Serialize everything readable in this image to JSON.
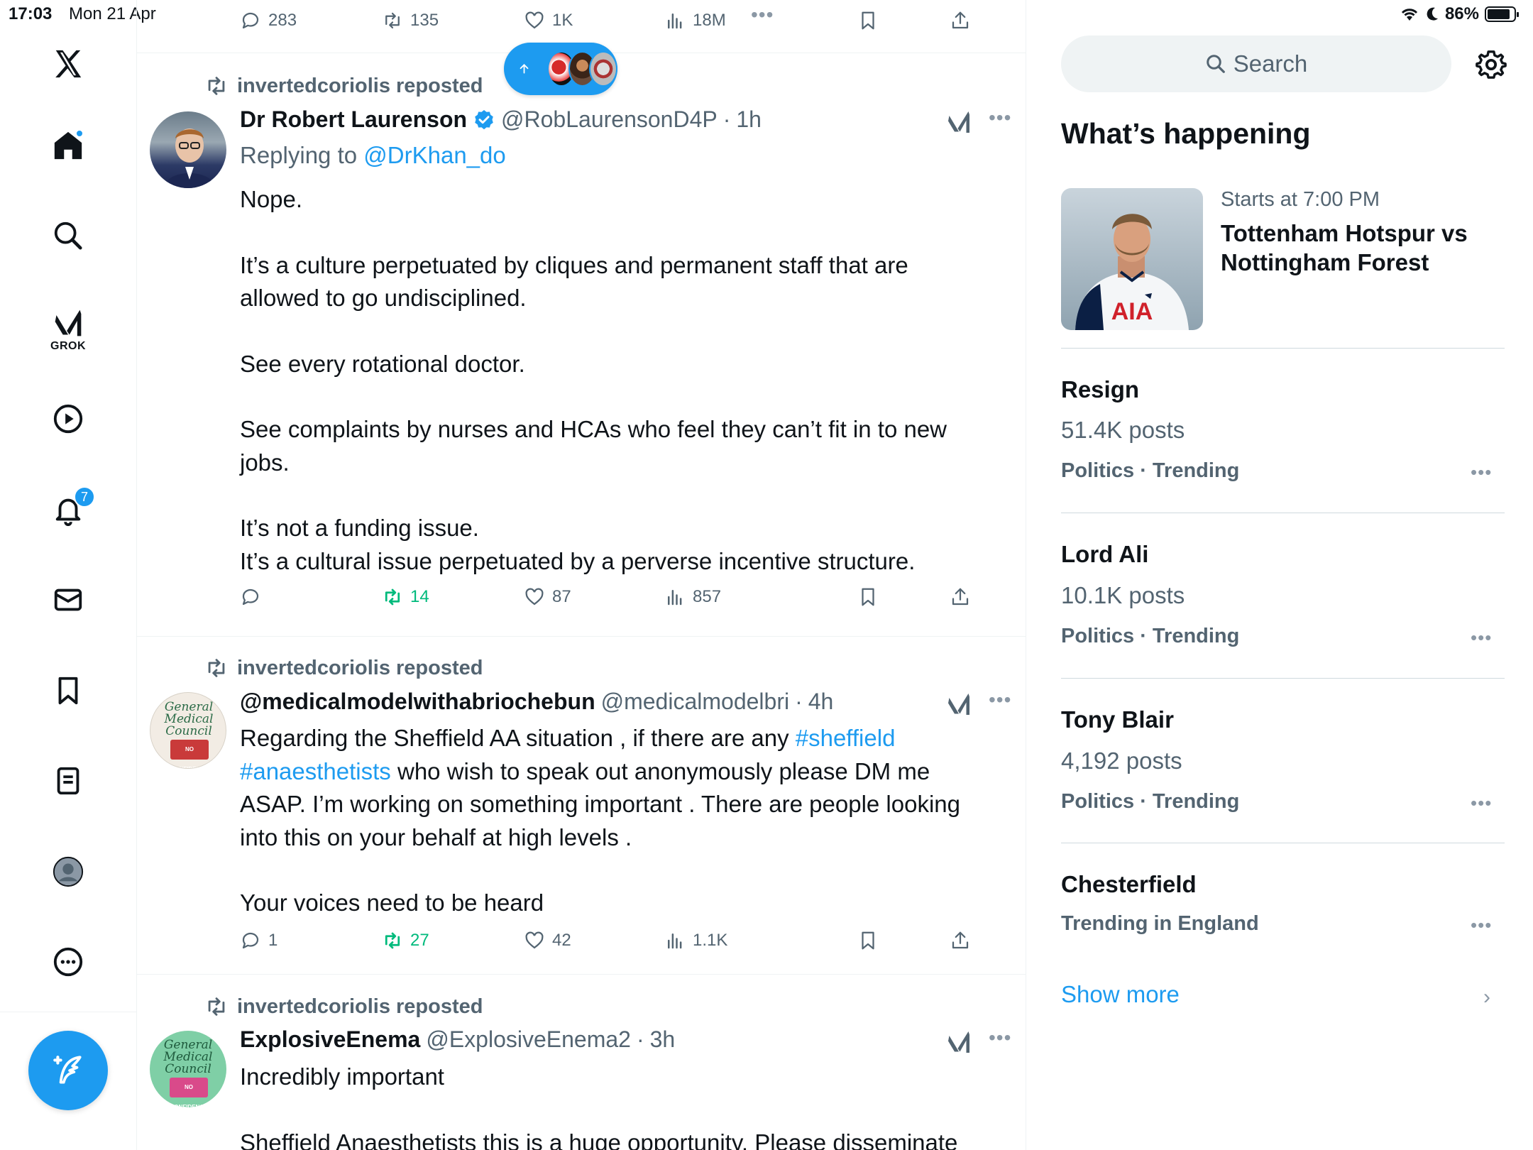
{
  "status_bar": {
    "time": "17:03",
    "date": "Mon 21 Apr",
    "battery": "86%",
    "battery_level": 0.86
  },
  "nav": {
    "grok_label": "GROK",
    "notifications_badge": "7"
  },
  "top_actions": {
    "replies": "283",
    "reposts": "135",
    "likes": "1K",
    "views": "18M"
  },
  "posts": [
    {
      "repost_label": "invertedcoriolis reposted",
      "name": "Dr Robert Laurenson",
      "handle": "@RobLaurensonD4P",
      "time": "1h",
      "replying_prefix": "Replying to",
      "replying_handle": "@DrKhan_do",
      "lines": [
        "Nope.",
        "",
        "It’s a culture perpetuated by cliques and permanent staff that are allowed to go undisciplined.",
        "",
        "See every rotational doctor.",
        "",
        "See complaints by nurses and HCAs who feel they can’t fit in to new jobs.",
        "",
        "It’s not a funding issue.",
        "It’s a cultural issue perpetuated by a perverse incentive structure."
      ],
      "replies": "",
      "reposts": "14",
      "likes": "87",
      "views": "857"
    },
    {
      "repost_label": "invertedcoriolis reposted",
      "name": "@medicalmodelwithabriochebun",
      "handle": "@medicalmodelbri",
      "time": "4h",
      "text_a": "Regarding the Sheffield AA situation , if there are any ",
      "tag1": "#sheffield",
      "tag2": "#anaesthetists",
      "text_b": " who wish to speak out anonymously please DM me ASAP. I’m working on something important . There are people looking into this on your behalf at high levels .",
      "text_c": "Your voices need to be heard",
      "replies": "1",
      "reposts": "27",
      "likes": "42",
      "views": "1.1K"
    },
    {
      "repost_label": "invertedcoriolis reposted",
      "name": "ExplosiveEnema",
      "handle": "@ExplosiveEnema2",
      "time": "3h",
      "text_a": "Incredibly important",
      "text_b": "Sheffield Anaesthetists this is a huge opportunity. Please disseminate"
    }
  ],
  "sidebar": {
    "search_placeholder": "Search",
    "heading": "What’s happening",
    "event": {
      "time": "Starts at 7:00 PM",
      "title": "Tottenham Hotspur vs Nottingham Forest",
      "shirt_text": "AIA"
    },
    "trends": [
      {
        "title": "Resign",
        "count": "51.4K posts",
        "category": "Politics · Trending"
      },
      {
        "title": "Lord Ali",
        "count": "10.1K posts",
        "category": "Politics · Trending"
      },
      {
        "title": "Tony Blair",
        "count": "4,192 posts",
        "category": "Politics · Trending"
      },
      {
        "title": "Chesterfield",
        "count": "",
        "category": "Trending in England"
      }
    ],
    "show_more": "Show more"
  },
  "gmc_avatar_text": [
    "General",
    "Medical",
    "Council",
    "NO CONFIDENCE"
  ],
  "colors": {
    "accent": "#1d9bf0",
    "repost_green": "#00ba7c",
    "muted": "#536471"
  }
}
